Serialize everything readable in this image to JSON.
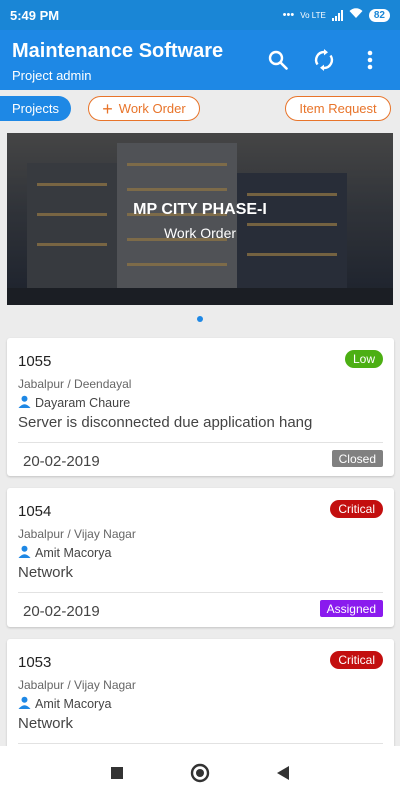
{
  "status_bar": {
    "time": "5:49 PM",
    "network": "Vo LTE",
    "battery": "82"
  },
  "app_bar": {
    "title": "Maintenance Software",
    "subtitle": "Project admin",
    "icons": [
      "search-icon",
      "sync-icon",
      "more-vert-icon"
    ]
  },
  "filters": {
    "projects_label": "Projects",
    "work_order_label": "Work Order",
    "item_request_label": "Item Request"
  },
  "banner": {
    "title": "MP CITY PHASE-I",
    "subtitle": "Work Order"
  },
  "colors": {
    "primary": "#1e88e5",
    "accent": "#e8742a",
    "low": "#4caf13",
    "critical": "#c30f0f",
    "closed": "#808080",
    "assigned": "#8a1aee"
  },
  "work_orders": [
    {
      "id": "1055",
      "location": "Jabalpur / Deendayal",
      "person": "Dayaram Chaure",
      "description": "Server is disconnected due application hang",
      "date": "20-02-2019",
      "priority": "Low",
      "status": "Closed"
    },
    {
      "id": "1054",
      "location": "Jabalpur / Vijay Nagar",
      "person": "Amit Macorya",
      "description": "Network",
      "date": "20-02-2019",
      "priority": "Critical",
      "status": "Assigned"
    },
    {
      "id": "1053",
      "location": "Jabalpur / Vijay Nagar",
      "person": "Amit Macorya",
      "description": "Network",
      "priority": "Critical"
    }
  ]
}
